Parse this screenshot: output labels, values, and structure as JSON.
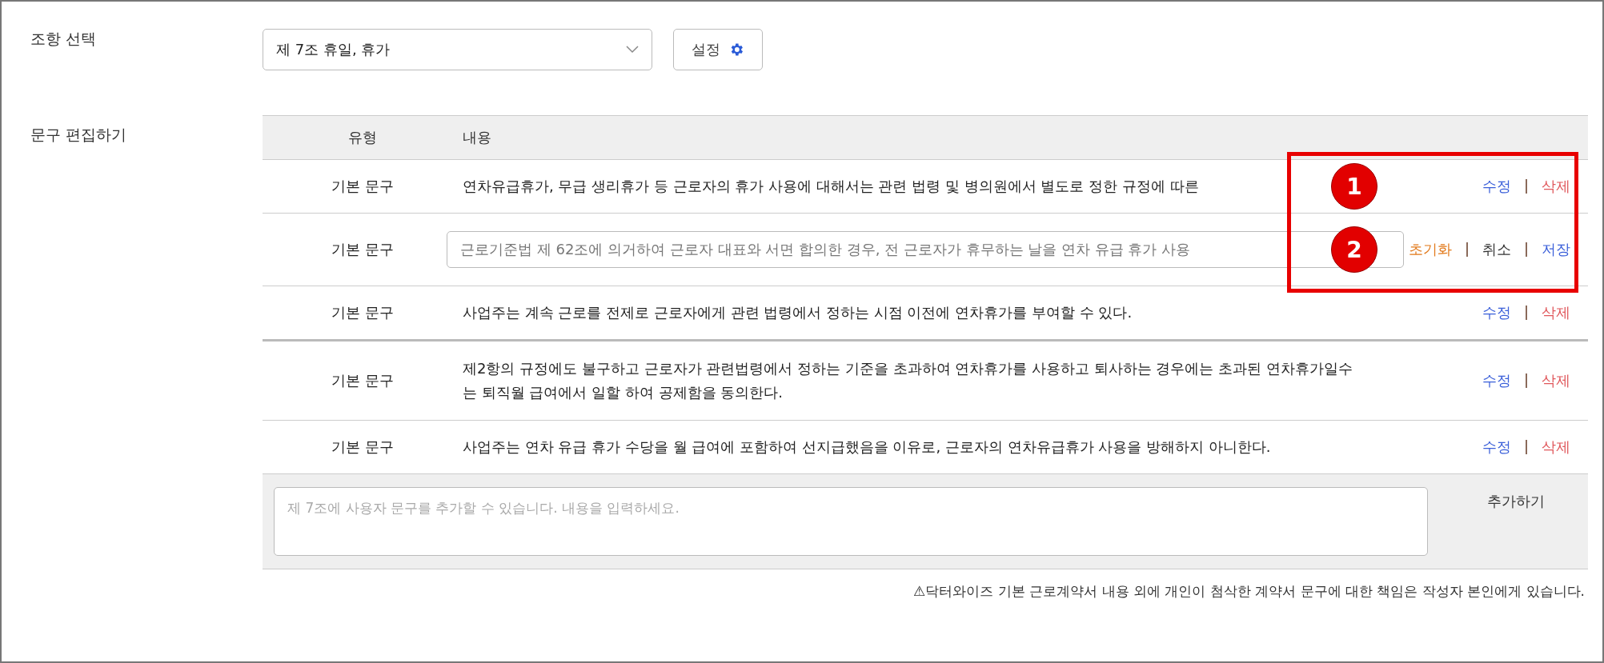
{
  "article_select": {
    "label": "조항 선택",
    "value": "제 7조 휴일, 휴가",
    "settings_button": "설정"
  },
  "editor": {
    "label": "문구 편집하기",
    "columns": [
      "유형",
      "내용"
    ],
    "rows": [
      {
        "kind": "text",
        "type": "기본 문구",
        "content": "연차유급휴가, 무급 생리휴가 등 근로자의 휴가 사용에 대해서는 관련 법령 및 병의원에서 별도로 정한 규정에 따른",
        "callout": "1",
        "actions": [
          {
            "kind": "edit",
            "label": "수정"
          },
          {
            "kind": "delete",
            "label": "삭제"
          }
        ]
      },
      {
        "kind": "editing",
        "type": "기본 문구",
        "content": "근로기준법 제 62조에 의거하여 근로자 대표와 서면 합의한 경우, 전 근로자가 휴무하는 날을 연차 유급 휴가 사용",
        "callout": "2",
        "actions": [
          {
            "kind": "reset",
            "label": "초기화"
          },
          {
            "kind": "cancel",
            "label": "취소"
          },
          {
            "kind": "save",
            "label": "저장"
          }
        ]
      },
      {
        "kind": "text",
        "type": "기본 문구",
        "content": "사업주는 계속 근로를 전제로 근로자에게 관련 법령에서 정하는 시점 이전에 연차휴가를 부여할 수 있다.",
        "actions": [
          {
            "kind": "edit",
            "label": "수정"
          },
          {
            "kind": "delete",
            "label": "삭제"
          }
        ]
      },
      {
        "kind": "text",
        "type": "기본 문구",
        "content": "제2항의 규정에도 불구하고 근로자가 관련법령에서 정하는 기준을 초과하여 연차휴가를 사용하고 퇴사하는 경우에는 초과된 연차휴가일수는 퇴직월 급여에서 일할 하여 공제함을 동의한다.",
        "actions": [
          {
            "kind": "edit",
            "label": "수정"
          },
          {
            "kind": "delete",
            "label": "삭제"
          }
        ]
      },
      {
        "kind": "text",
        "type": "기본 문구",
        "content": "사업주는 연차 유급 휴가 수당을 월 급여에 포함하여 선지급했음을 이유로, 근로자의 연차유급휴가 사용을 방해하지 아니한다.",
        "actions": [
          {
            "kind": "edit",
            "label": "수정"
          },
          {
            "kind": "delete",
            "label": "삭제"
          }
        ]
      }
    ],
    "add": {
      "placeholder": "제 7조에 사용자 문구를 추가할 수 있습니다. 내용을 입력하세요.",
      "button": "추가하기"
    }
  },
  "notice": "⚠닥터와이즈 기본 근로계약서 내용 외에 개인이 첨삭한 계약서 문구에 대한 책임은 작성자 본인에게 있습니다."
}
